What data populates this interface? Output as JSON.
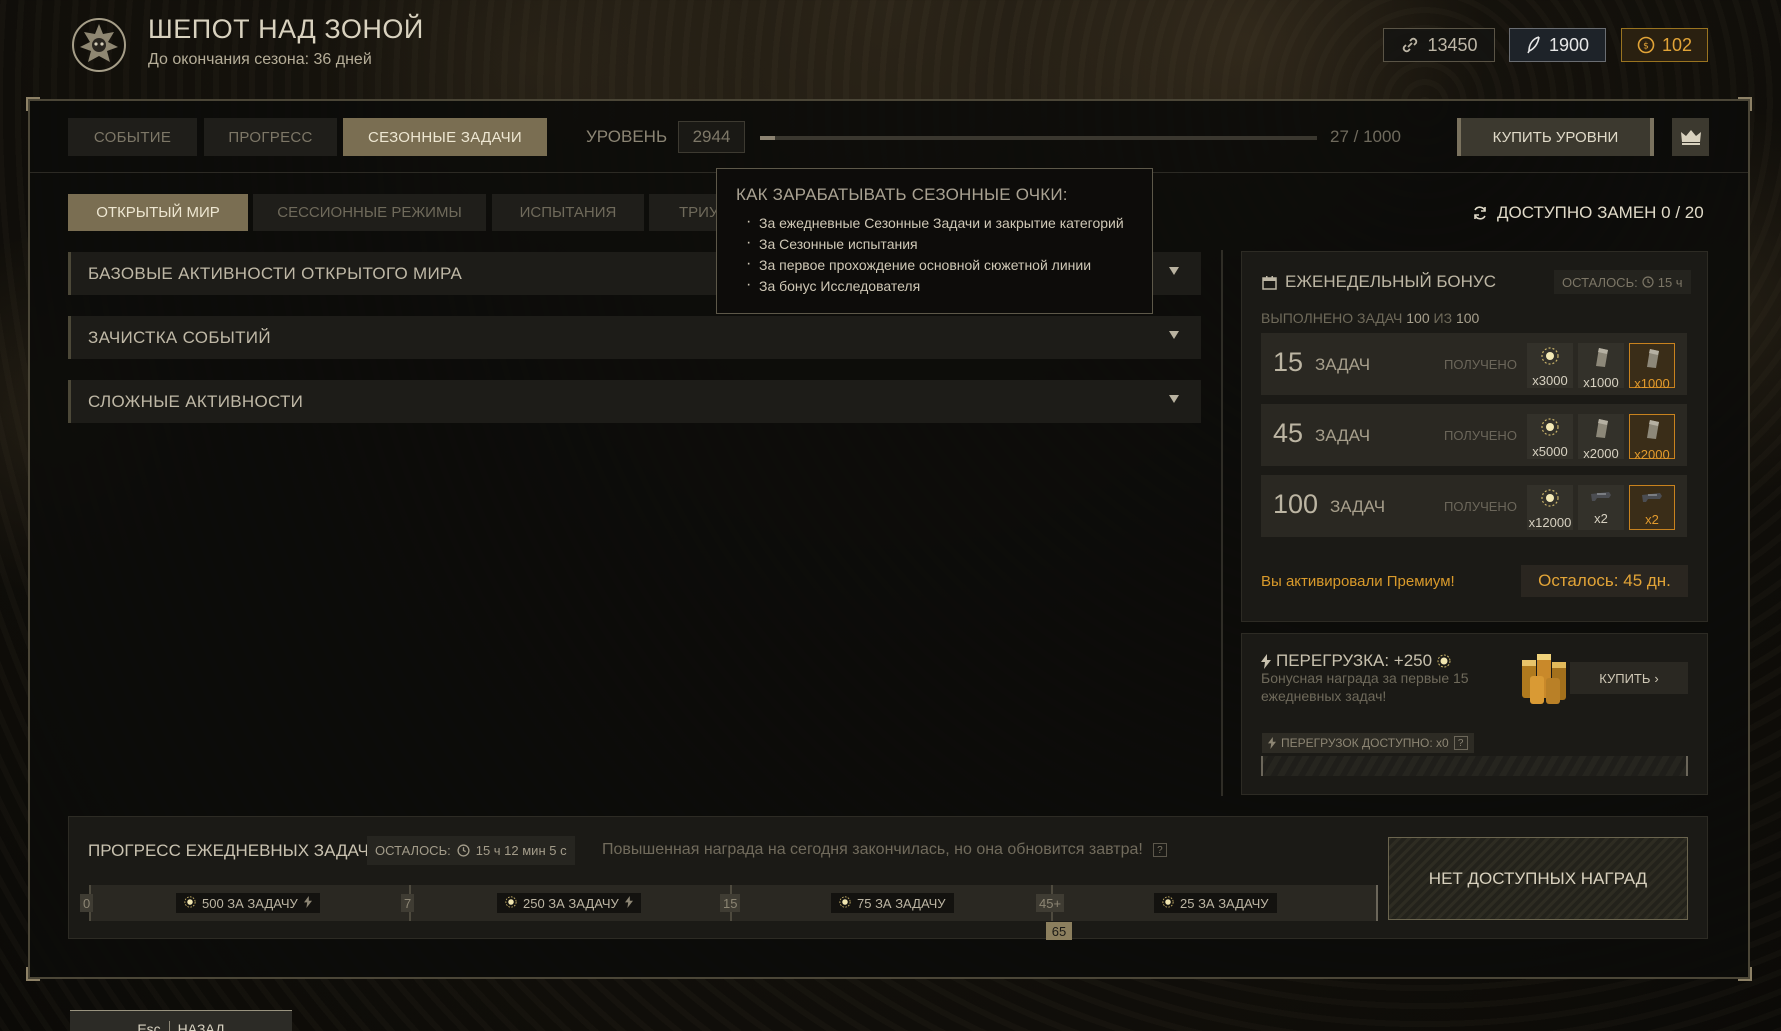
{
  "header": {
    "title": "ШЕПОТ НАД ЗОНОЙ",
    "subtitle": "До окончания сезона: 36 дней"
  },
  "currencies": [
    {
      "icon": "link-icon",
      "value": "13450"
    },
    {
      "icon": "feather-icon",
      "value": "1900"
    },
    {
      "icon": "gold-coin-icon",
      "value": "102",
      "color": "#e2a437"
    }
  ],
  "tabs": [
    {
      "label": "СОБЫТИЕ",
      "active": false
    },
    {
      "label": "ПРОГРЕСС",
      "active": false
    },
    {
      "label": "СЕЗОННЫЕ ЗАДАЧИ",
      "active": true
    }
  ],
  "level": {
    "label": "УРОВЕНЬ",
    "value": "2944",
    "progress_text": "27 / 1000",
    "progress_fraction": 0.027,
    "buy_label": "КУПИТЬ УРОВНИ"
  },
  "subtabs": [
    {
      "label": "ОТКРЫТЫЙ МИР",
      "active": true
    },
    {
      "label": "СЕССИОННЫЕ РЕЖИМЫ",
      "active": false
    },
    {
      "label": "ИСПЫТАНИЯ",
      "active": false
    },
    {
      "label": "ТРИУ",
      "active": false
    }
  ],
  "replacements": "ДОСТУПНО ЗАМЕН 0 / 20",
  "accordions": [
    {
      "label": "БАЗОВЫЕ АКТИВНОСТИ ОТКРЫТОГО МИРА"
    },
    {
      "label": "ЗАЧИСТКА СОБЫТИЙ"
    },
    {
      "label": "СЛОЖНЫЕ АКТИВНОСТИ"
    }
  ],
  "tooltip": {
    "title": "КАК ЗАРАБАТЫВАТЬ СЕЗОННЫЕ ОЧКИ:",
    "items": [
      "За ежедневные Сезонные Задачи и закрытие категорий",
      "За Сезонные испытания",
      "За первое прохождение основной сюжетной линии",
      "За бонус Исследователя"
    ]
  },
  "weekly": {
    "title": "ЕЖЕНЕДЕЛЬНЫЙ БОНУС",
    "left_label": "ОСТАЛОСЬ:",
    "left_value": "15 ч",
    "done_prefix": "ВЫПОЛНЕНО ЗАДАЧ",
    "done_value": "100",
    "done_of": "ИЗ",
    "done_total": "100",
    "tiers": [
      {
        "num": "15",
        "word": "ЗАДАЧ",
        "status": "ПОЛУЧЕНО",
        "rewards": [
          {
            "icon": "sun-icon",
            "qty": "x3000"
          },
          {
            "icon": "plate-icon",
            "qty": "x1000"
          },
          {
            "icon": "plate-icon",
            "qty": "x1000",
            "premium": true
          }
        ]
      },
      {
        "num": "45",
        "word": "ЗАДАЧ",
        "status": "ПОЛУЧЕНО",
        "rewards": [
          {
            "icon": "sun-icon",
            "qty": "x5000"
          },
          {
            "icon": "plate-icon",
            "qty": "x2000"
          },
          {
            "icon": "plate-icon",
            "qty": "x2000",
            "premium": true
          }
        ]
      },
      {
        "num": "100",
        "word": "ЗАДАЧ",
        "status": "ПОЛУЧЕНО",
        "rewards": [
          {
            "icon": "sun-icon",
            "qty": "x12000"
          },
          {
            "icon": "weapon-icon",
            "qty": "x2"
          },
          {
            "icon": "weapon-icon",
            "qty": "x2",
            "premium": true
          }
        ]
      }
    ],
    "premium_text": "Вы активировали Премиум!",
    "premium_left": "Осталось: 45 дн."
  },
  "overload": {
    "title": "ПЕРЕГРУЗКА: +250",
    "desc": "Бонусная награда за первые 15 ежедневных задач!",
    "buy_label": "КУПИТЬ",
    "available": "ПЕРЕГРУЗОК ДОСТУПНО: x0",
    "help": "?"
  },
  "daily": {
    "title": "ПРОГРЕСС ЕЖЕДНЕВНЫХ ЗАДАЧ",
    "left_label": "ОСТАЛОСЬ:",
    "left_value": "15 ч 12 мин 5 с",
    "note": "Повышенная награда на сегодня закончилась, но она обновится завтра!",
    "help": "?",
    "marks": [
      "0",
      "7",
      "15",
      "45+"
    ],
    "segments": [
      "500 ЗА ЗАДАЧУ",
      "250 ЗА ЗАДАЧУ",
      "75 ЗА ЗАДАЧУ",
      "25 ЗА ЗАДАЧУ"
    ],
    "current": "65",
    "no_rewards": "НЕТ ДОСТУПНЫХ НАГРАД"
  },
  "back": {
    "key": "Esc",
    "label": "НАЗАД"
  }
}
